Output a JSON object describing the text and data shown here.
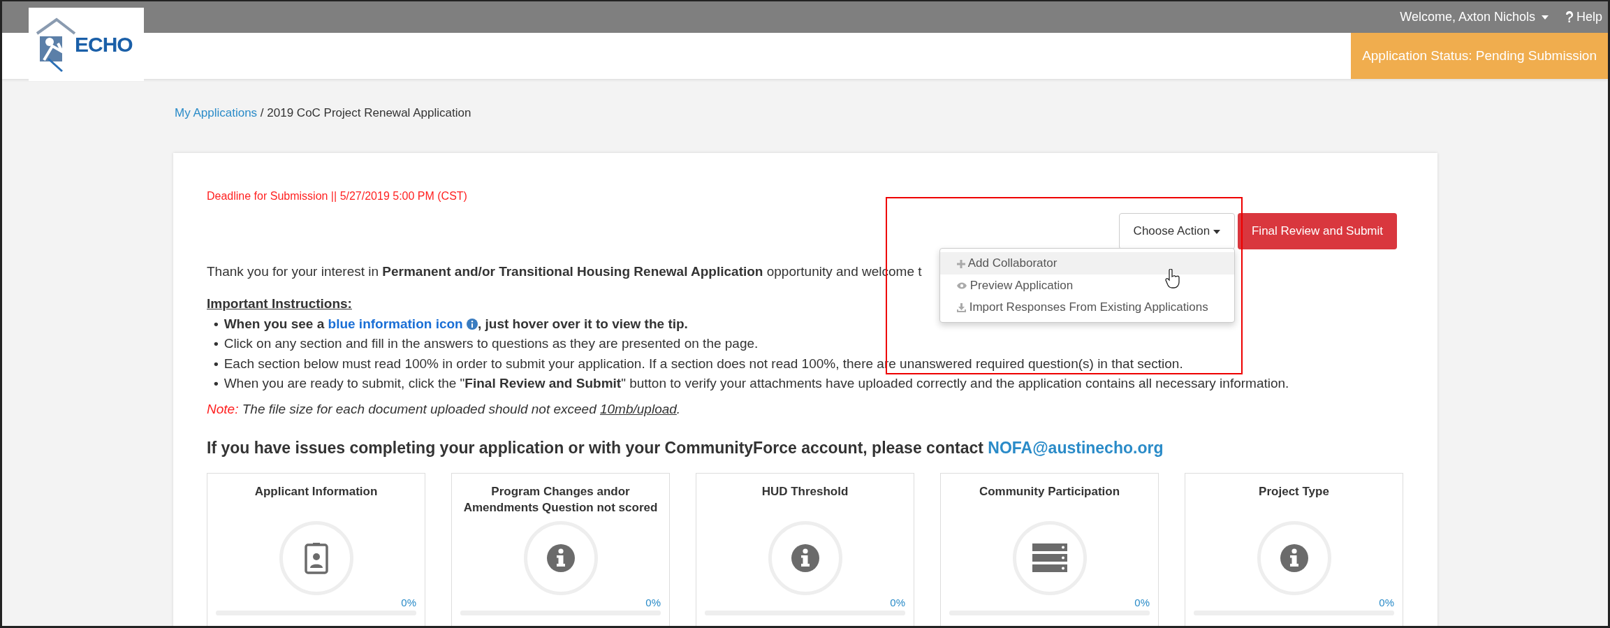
{
  "topbar": {
    "welcome": "Welcome, Axton Nichols",
    "help": "Help"
  },
  "logo": {
    "text": "ECHO"
  },
  "status": {
    "text": "Application Status: Pending Submission"
  },
  "breadcrumb": [
    {
      "label": "My Applications",
      "kind": "link"
    },
    {
      "label": "/",
      "kind": "text"
    },
    {
      "label": "2019 CoC Project Renewal Application",
      "kind": "text"
    }
  ],
  "deadline": "Deadline for Submission || 5/27/2019 5:00 PM (CST)",
  "actions": {
    "choose": "Choose Action",
    "submit": "Final Review and Submit",
    "menu": [
      {
        "label": "Add Collaborator",
        "kind": "plus",
        "selected": true
      },
      {
        "label": "Preview Application",
        "kind": "eye",
        "selected": false
      },
      {
        "label": "Import Responses From Existing Applications",
        "kind": "download",
        "selected": false
      }
    ]
  },
  "intro": "Thank you for your interest in **Permanent and/or Transitional Housing Renewal Application** opportunity and welcome t",
  "instructions": {
    "heading": "Important Instructions:",
    "items": [
      {
        "marker": "•",
        "before": "When you see a ",
        "link": "blue information icon",
        "after": ", just hover over it to view the tip.",
        "kind": "tip"
      },
      {
        "marker": "•",
        "text": "Click on any section and fill in the answers to questions as they are presented on the page.",
        "kind": "plain"
      },
      {
        "marker": "•",
        "text": "Each section below must read 100% in order to submit your application. If a section does not read 100%, there are unanswered required question(s) in that section.",
        "kind": "plain"
      },
      {
        "marker": "•",
        "text": "When you are ready to submit, click the \"**Final Review and Submit**\" button to verify your attachments have uploaded correctly and the application contains all necessary information.",
        "kind": "plain"
      }
    ]
  },
  "note": {
    "label": "Note:",
    "text": "The file size for each document uploaded should not exceed ",
    "underlined": "10mb/upload",
    "end": "."
  },
  "contact": {
    "text": "If you have issues completing your application or with your CommunityForce account, please contact ",
    "email": "NOFA@austinecho.org"
  },
  "sections": [
    {
      "title": "Applicant Information",
      "kind": "badge",
      "percent": "0%",
      "level": 0
    },
    {
      "title": "Program Changes andor Amendments Question not scored",
      "kind": "info",
      "percent": "0%",
      "level": 0
    },
    {
      "title": "HUD Threshold",
      "kind": "info",
      "percent": "0%",
      "level": 0
    },
    {
      "title": "Community Participation",
      "kind": "server",
      "percent": "0%",
      "level": 0
    },
    {
      "title": "Project Type",
      "kind": "info",
      "percent": "0%",
      "level": 0
    }
  ]
}
